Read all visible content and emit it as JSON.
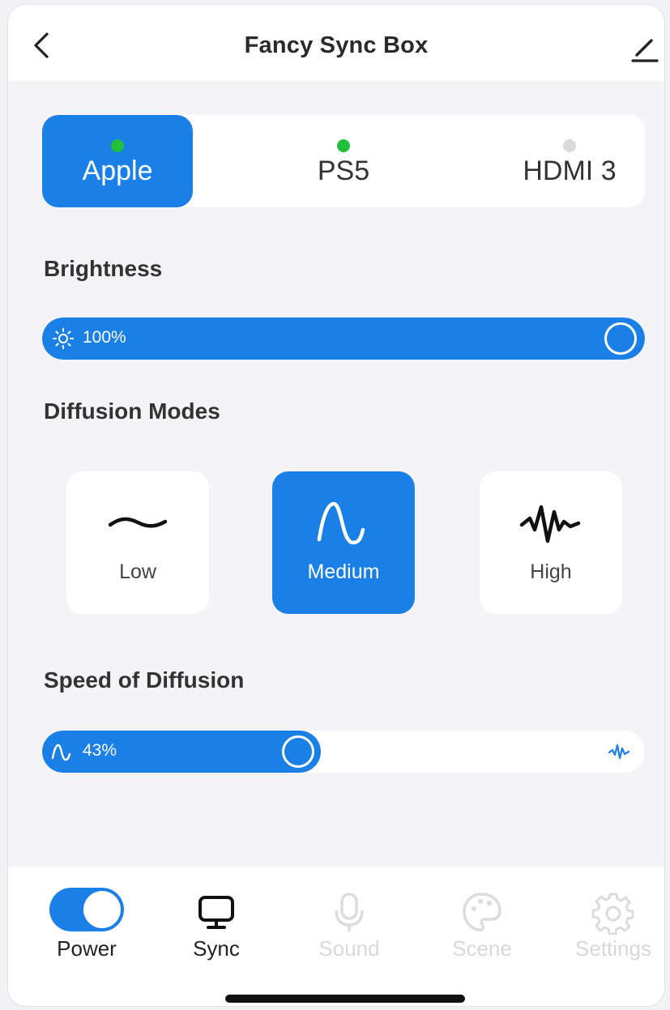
{
  "header": {
    "title": "Fancy Sync Box",
    "back_icon": "chevron-left-icon",
    "edit_icon": "pencil-icon"
  },
  "inputs": [
    {
      "label": "Apple",
      "status": "connected",
      "status_color": "#22c03a",
      "active": true
    },
    {
      "label": "PS5",
      "status": "connected",
      "status_color": "#22c03a",
      "active": false
    },
    {
      "label": "HDMI 3",
      "status": "disconnected",
      "status_color": "#dadada",
      "active": false
    }
  ],
  "brightness": {
    "label": "Brightness",
    "value_text": "100%",
    "value": 100,
    "icon": "sun-icon"
  },
  "diffusion_modes": {
    "label": "Diffusion Modes",
    "selected": "Medium",
    "modes": [
      {
        "label": "Low",
        "icon": "low-wave-icon"
      },
      {
        "label": "Medium",
        "icon": "medium-wave-icon"
      },
      {
        "label": "High",
        "icon": "high-wave-icon"
      }
    ]
  },
  "speed": {
    "label": "Speed of Diffusion",
    "value_text": "43%",
    "value": 43,
    "start_icon": "medium-wave-icon",
    "end_icon": "high-wave-icon"
  },
  "bottom_nav": [
    {
      "label": "Power",
      "icon": "power-toggle",
      "enabled": true,
      "toggle_on": true
    },
    {
      "label": "Sync",
      "icon": "monitor-icon",
      "enabled": true
    },
    {
      "label": "Sound",
      "icon": "microphone-icon",
      "enabled": false
    },
    {
      "label": "Scene",
      "icon": "palette-icon",
      "enabled": false
    },
    {
      "label": "Settings",
      "icon": "gear-icon",
      "enabled": false
    }
  ],
  "colors": {
    "accent": "#1a80e8",
    "connected": "#22c03a",
    "disabled": "#dadada"
  }
}
